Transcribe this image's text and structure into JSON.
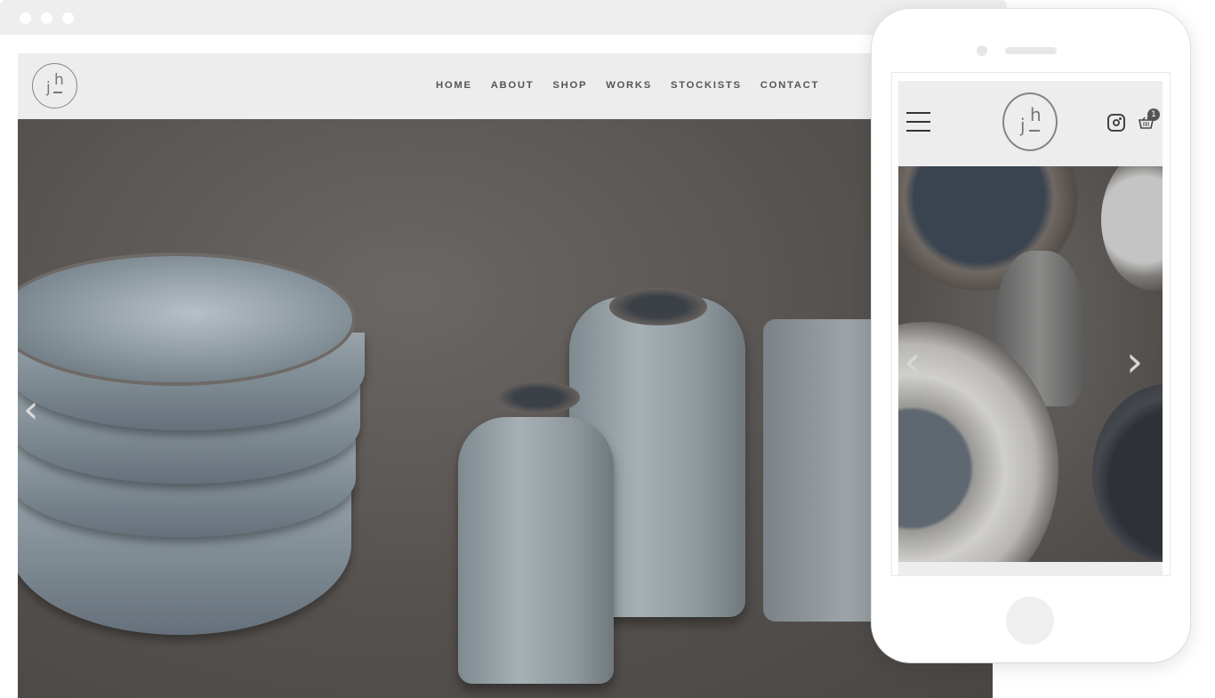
{
  "desktop": {
    "logo": {
      "letter_j": "j",
      "letter_h": "h"
    },
    "nav": [
      "HOME",
      "ABOUT",
      "SHOP",
      "WORKS",
      "STOCKISTS",
      "CONTACT"
    ],
    "hero": {
      "prev_glyph": "‹"
    }
  },
  "mobile": {
    "logo": {
      "letter_j": "j",
      "letter_h": "h"
    },
    "cart_count": "1",
    "hero": {
      "prev_glyph": "‹",
      "next_glyph": "›"
    }
  },
  "colors": {
    "header_bg": "#ededed",
    "logo_stroke": "#8a8287",
    "nav_text": "#555555"
  },
  "icons": [
    "hamburger-menu-icon",
    "instagram-icon",
    "shopping-basket-icon"
  ]
}
